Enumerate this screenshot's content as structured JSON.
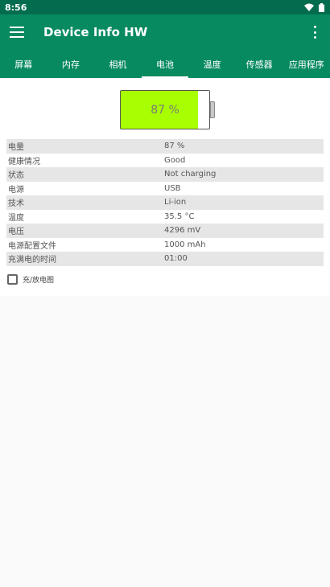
{
  "status_bar": {
    "time": "8:56",
    "icons": [
      "wifi-icon",
      "battery-icon"
    ]
  },
  "app_bar": {
    "title": "Device Info HW",
    "icons": [
      "menu-icon",
      "overflow-menu-icon"
    ]
  },
  "tabs": [
    {
      "label": "屏幕",
      "active": false
    },
    {
      "label": "内存",
      "active": false
    },
    {
      "label": "相机",
      "active": false
    },
    {
      "label": "电池",
      "active": true
    },
    {
      "label": "温度",
      "active": false
    },
    {
      "label": "传感器",
      "active": false
    },
    {
      "label": "应用程序",
      "active": false
    }
  ],
  "battery_graphic": {
    "level_text": "87 %",
    "level_fraction": 0.87,
    "fill_color": "#a8ff00"
  },
  "info_rows": [
    {
      "label": "电量",
      "value": "87 %"
    },
    {
      "label": "健康情况",
      "value": "Good"
    },
    {
      "label": "状态",
      "value": "Not charging"
    },
    {
      "label": "电源",
      "value": "USB"
    },
    {
      "label": "技术",
      "value": "Li-ion"
    },
    {
      "label": "温度",
      "value": "35.5 °C"
    },
    {
      "label": "电压",
      "value": "4296 mV"
    },
    {
      "label": "电源配置文件",
      "value": "1000 mAh"
    },
    {
      "label": "充满电的时间",
      "value": "01:00"
    }
  ],
  "chart_toggle": {
    "label": "充/放电图",
    "checked": false
  },
  "colors": {
    "status_bar": "#046c4e",
    "primary": "#078a60",
    "row_alt": "#e6e6e6"
  }
}
